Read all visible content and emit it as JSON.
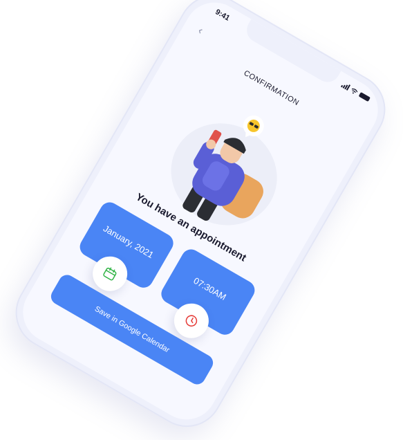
{
  "status_bar": {
    "time": "9:41"
  },
  "header": {
    "title": "CONFIRMATION",
    "back_icon": "chevron-left-icon"
  },
  "illustration": {
    "icon": "person-with-phone-and-backpack-illustration",
    "emoji": "sunglasses-emoji"
  },
  "main": {
    "headline": "You have an appointment",
    "date_card": {
      "value": "January, 2021",
      "icon": "calendar-icon",
      "icon_color": "#2fb344"
    },
    "time_card": {
      "value": "07:30AM",
      "icon": "clock-icon",
      "icon_color": "#e53935"
    },
    "save_button": {
      "label": "Save in Google Calendar"
    }
  },
  "colors": {
    "accent": "#4a85f5",
    "screen": "#f7f8ff",
    "frame": "#eef0fb",
    "text": "#1a1a2e"
  }
}
